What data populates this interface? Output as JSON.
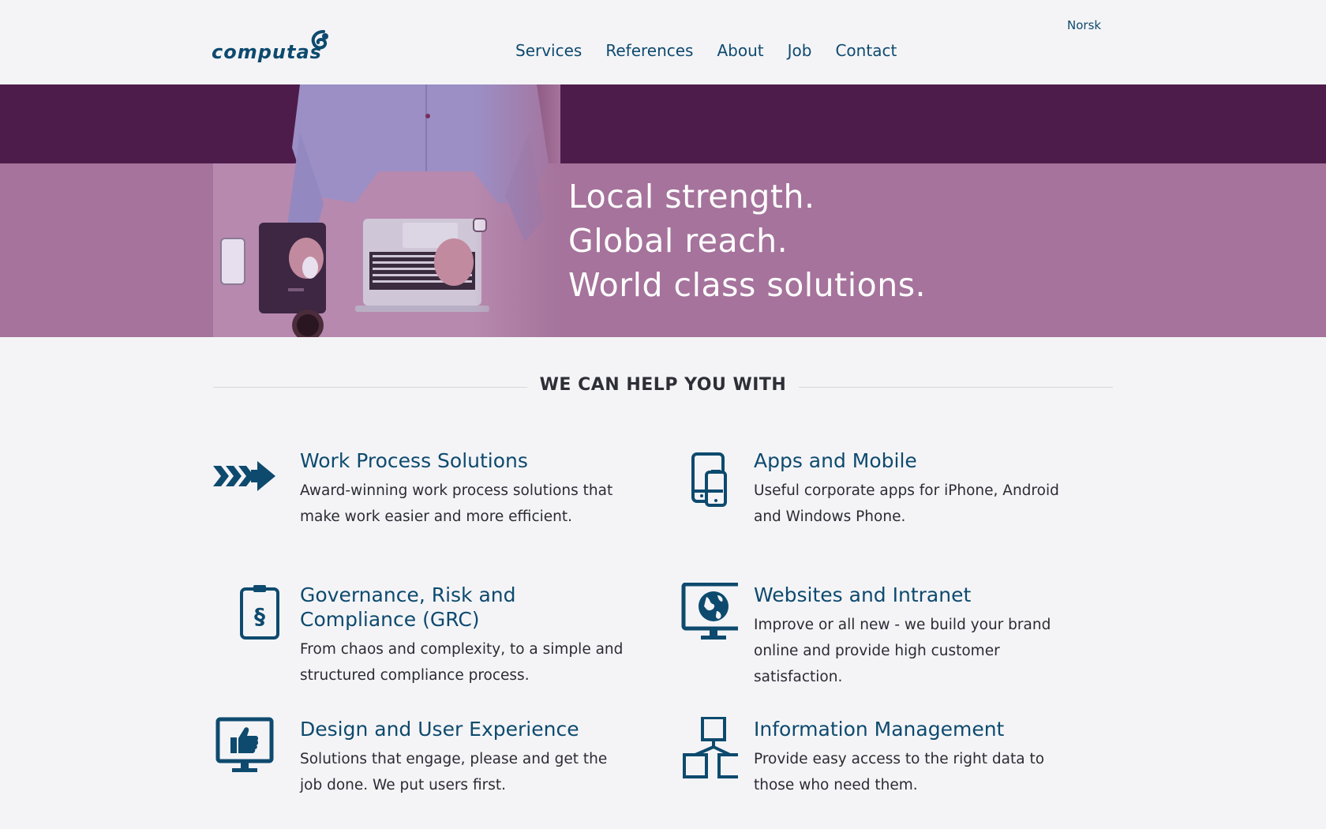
{
  "header": {
    "logo_text": "computas",
    "nav": [
      {
        "label": "Services"
      },
      {
        "label": "References"
      },
      {
        "label": "About"
      },
      {
        "label": "Job"
      },
      {
        "label": "Contact"
      }
    ],
    "language_link": "Norsk"
  },
  "hero": {
    "lines": [
      "Local strength.",
      "Global reach.",
      "World class solutions."
    ],
    "colors": {
      "band": "#4e1c4b",
      "overlay": "#a5739b"
    }
  },
  "services": {
    "heading": "WE CAN HELP YOU WITH",
    "items": [
      {
        "icon": "arrows-icon",
        "title": "Work Process Solutions",
        "desc": "Award-winning work process solutions that make work easier and more efficient."
      },
      {
        "icon": "mobile-devices-icon",
        "title": "Apps and Mobile",
        "desc": "Useful corporate apps for iPhone, Android and Windows Phone."
      },
      {
        "icon": "clipboard-section-icon",
        "title": "Governance, Risk and Compliance (GRC)",
        "desc": "From chaos and complexity, to a simple and structured compliance process."
      },
      {
        "icon": "monitor-globe-icon",
        "title": "Websites and Intranet",
        "desc": "Improve or all new - we build your brand online and provide high customer satisfaction."
      },
      {
        "icon": "monitor-thumbs-up-icon",
        "title": "Design and User Experience",
        "desc": "Solutions that engage, please and get the job done. We put users first."
      },
      {
        "icon": "hierarchy-icon",
        "title": "Information Management",
        "desc": "Provide easy access to the right data to those who need them."
      }
    ]
  },
  "colors": {
    "brand": "#0e4a6e",
    "background": "#f4f4f7",
    "text": "#2b2b33"
  }
}
